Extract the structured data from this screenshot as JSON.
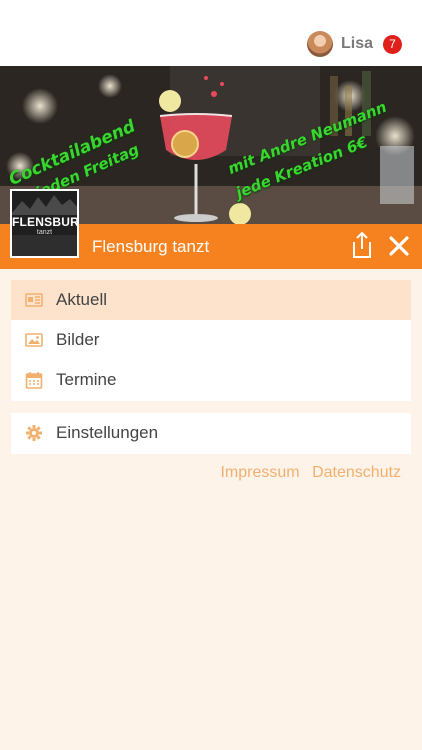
{
  "user": {
    "name": "Lisa",
    "notifications": "7"
  },
  "hero": {
    "text_left_1": "Cocktailabend",
    "text_left_2": "jeden Freitag",
    "text_right_1": "mit Andre Neumann",
    "text_right_2": "jede Kreation 6€"
  },
  "club": {
    "name": "Flensburg tanzt",
    "logo_text": "FLENSBURG",
    "logo_sub": "tanzt"
  },
  "menu": {
    "items": [
      {
        "label": "Aktuell",
        "icon": "news-icon"
      },
      {
        "label": "Bilder",
        "icon": "image-icon"
      },
      {
        "label": "Termine",
        "icon": "calendar-icon"
      }
    ],
    "settings": {
      "label": "Einstellungen",
      "icon": "gear-icon"
    }
  },
  "footer": {
    "impressum": "Impressum",
    "datenschutz": "Datenschutz"
  },
  "colors": {
    "accent": "#f5821f",
    "active_bg": "#fde2cc",
    "badge": "#e0201b",
    "link": "#f2b06f"
  }
}
